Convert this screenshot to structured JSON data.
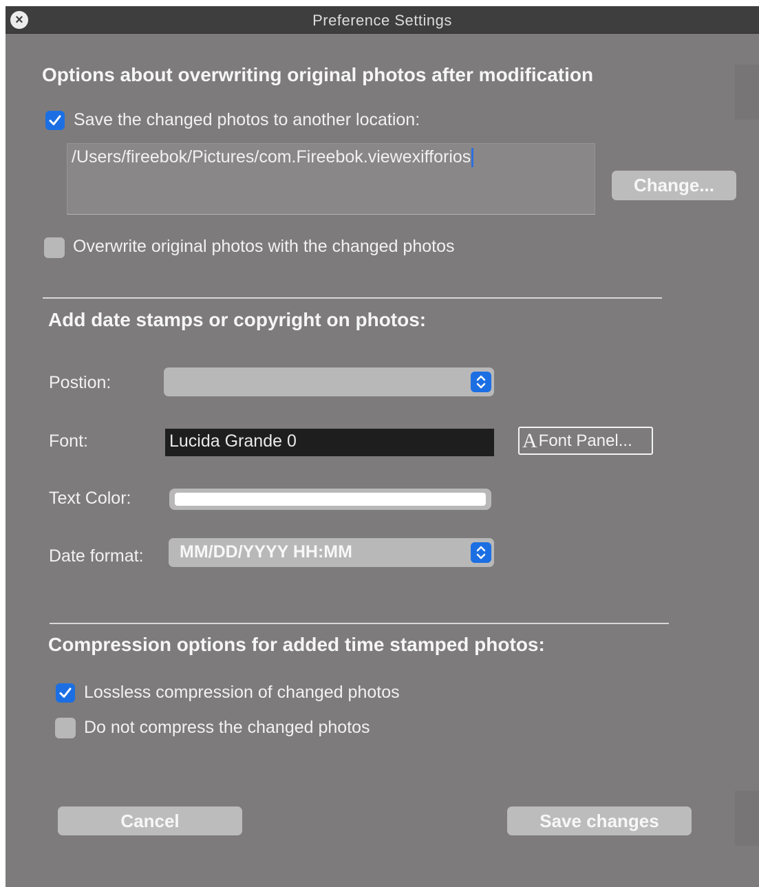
{
  "window": {
    "title": "Preference Settings"
  },
  "overwrite_section": {
    "heading": "Options about overwriting original photos after modification",
    "save_elsewhere_label": "Save the changed photos to another location:",
    "save_elsewhere_checked": true,
    "location_path": "/Users/fireebok/Pictures/com.Fireebok.viewexifforios",
    "change_button": "Change...",
    "overwrite_label": "Overwrite original photos with the changed photos",
    "overwrite_checked": false
  },
  "stamp_section": {
    "heading": "Add date stamps or copyright on photos:",
    "position_label": "Postion:",
    "position_value": "",
    "font_label": "Font:",
    "font_value": "Lucida Grande 0",
    "font_panel_button": {
      "glyph": "A",
      "label": "Font Panel..."
    },
    "text_color_label": "Text Color:",
    "text_color": "#ffffff",
    "date_format_label": "Date format:",
    "date_format_value": "MM/DD/YYYY HH:MM"
  },
  "compression_section": {
    "heading": "Compression options for added time stamped photos:",
    "lossless_label": "Lossless compression of changed photos",
    "lossless_checked": true,
    "no_compress_label": "Do not compress the changed photos",
    "no_compress_checked": false
  },
  "footer": {
    "cancel_button": "Cancel",
    "save_button": "Save changes"
  },
  "colors": {
    "window_bg": "#7d7b7c",
    "titlebar_bg": "#3f3e3f",
    "accent": "#1c6fe3",
    "button_bg": "#bdbcbd"
  },
  "icons": {
    "close": "close-icon",
    "check": "checkmark-icon",
    "stepper": "up-down-chevron-icon"
  }
}
